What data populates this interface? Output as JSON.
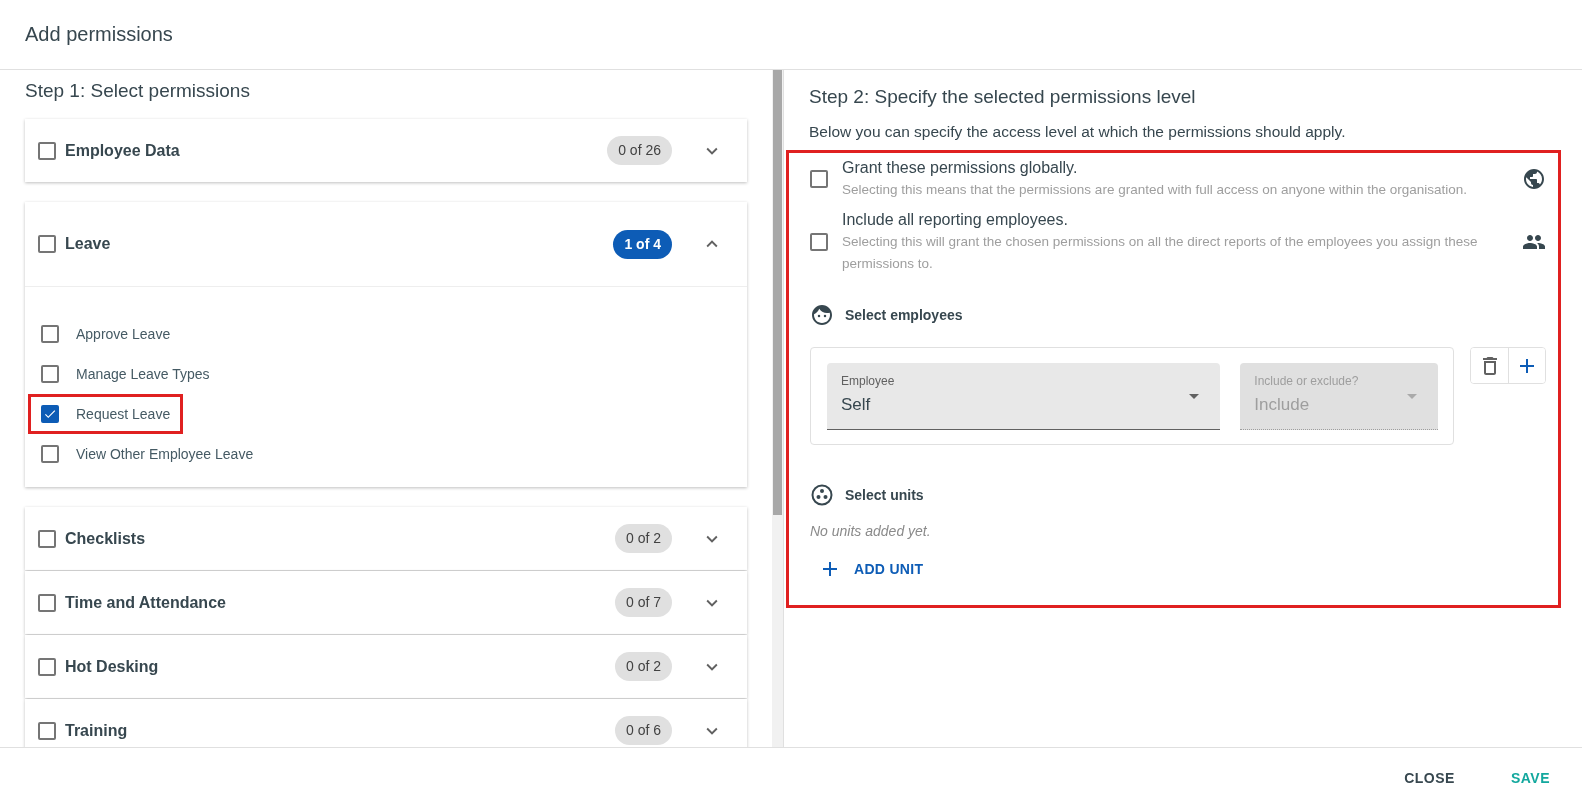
{
  "dialog_title": "Add permissions",
  "step1": {
    "heading": "Step 1: Select permissions",
    "categories": [
      {
        "name": "Employee Data",
        "checked": false,
        "count": "0 of 26",
        "has_selection": false,
        "expanded": false
      },
      {
        "name": "Leave",
        "checked": false,
        "count": "1 of 4",
        "has_selection": true,
        "expanded": true,
        "permissions": [
          {
            "name": "Approve Leave",
            "checked": false,
            "highlighted": false
          },
          {
            "name": "Manage Leave Types",
            "checked": false,
            "highlighted": false
          },
          {
            "name": "Request Leave",
            "checked": true,
            "highlighted": true
          },
          {
            "name": "View Other Employee Leave",
            "checked": false,
            "highlighted": false
          }
        ]
      },
      {
        "name": "Checklists",
        "checked": false,
        "count": "0 of 2",
        "has_selection": false,
        "expanded": false
      },
      {
        "name": "Time and Attendance",
        "checked": false,
        "count": "0 of 7",
        "has_selection": false,
        "expanded": false
      },
      {
        "name": "Hot Desking",
        "checked": false,
        "count": "0 of 2",
        "has_selection": false,
        "expanded": false
      },
      {
        "name": "Training",
        "checked": false,
        "count": "0 of 6",
        "has_selection": false,
        "expanded": false
      }
    ]
  },
  "step2": {
    "heading": "Step 2: Specify the selected permissions level",
    "description": "Below you can specify the access level at which the permissions should apply.",
    "highlighted": true,
    "options": [
      {
        "kind": "global",
        "title": "Grant these permissions globally.",
        "description": "Selecting this means that the permissions are granted with full access on anyone within the organisation.",
        "checked": false
      },
      {
        "kind": "reporting",
        "title": "Include all reporting employees.",
        "description": "Selecting this will grant the chosen permissions on all the direct reports of the employees you assign these permissions to.",
        "checked": false
      }
    ],
    "employees": {
      "heading": "Select employees",
      "fields": [
        {
          "label": "Employee",
          "value": "Self",
          "disabled": false
        },
        {
          "label": "Include or exclude?",
          "value": "Include",
          "disabled": true
        }
      ]
    },
    "units": {
      "heading": "Select units",
      "empty_text": "No units added yet.",
      "add_button": "ADD UNIT"
    }
  },
  "footer": {
    "buttons": [
      {
        "label": "CLOSE",
        "kind": "secondary"
      },
      {
        "label": "SAVE",
        "kind": "primary"
      }
    ]
  }
}
